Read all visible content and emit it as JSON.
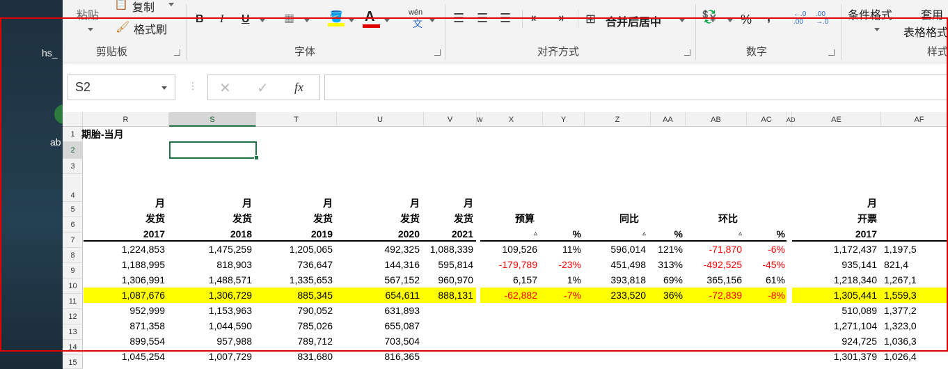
{
  "desktop": {
    "labels": [
      "hs_",
      "ab"
    ]
  },
  "ribbon": {
    "clipboard": {
      "paste": "粘贴",
      "copy": "复制",
      "format_painter": "格式刷",
      "group_label": "剪贴板"
    },
    "font": {
      "bold": "B",
      "italic": "I",
      "underline": "U",
      "group_label": "字体",
      "pinyin": "wén"
    },
    "alignment": {
      "merge_center": "合并后居中",
      "group_label": "对齐方式"
    },
    "number": {
      "percent": "%",
      "comma": ",",
      "group_label": "数字"
    },
    "styles": {
      "conditional_format": "条件格式",
      "table_format_1": "套用",
      "table_format_2": "表格格式",
      "group_label": "样式"
    }
  },
  "formula_bar": {
    "name_box": "S2",
    "cancel": "✕",
    "enter": "✓",
    "fx": "fx",
    "value": ""
  },
  "columns": [
    "R",
    "S",
    "T",
    "U",
    "V",
    "W",
    "X",
    "Y",
    "Z",
    "AA",
    "AB",
    "AC",
    "AD",
    "AE",
    "AF"
  ],
  "rows": [
    "1",
    "2",
    "3",
    "4",
    "5",
    "6",
    "7",
    "8",
    "9",
    "10",
    "11",
    "12",
    "13",
    "14",
    "15"
  ],
  "sheet": {
    "title": "期胎-当月",
    "hdr_month": "月",
    "hdr_shipment": "发货",
    "hdr_invoice": "开票",
    "hdr_budget": "预算",
    "hdr_yoy": "同比",
    "hdr_mom": "环比",
    "delta": "▵",
    "pct": "%",
    "years": [
      "2017",
      "2018",
      "2019",
      "2020",
      "2021"
    ],
    "ae_year": "2017",
    "af_header_fragments": [
      "开",
      "2"
    ],
    "data": [
      {
        "row": "8",
        "r": "1,224,853",
        "s": "1,475,259",
        "t": "1,205,065",
        "u": "492,325",
        "v": "1,088,339",
        "x": "109,526",
        "y": "11%",
        "z": "596,014",
        "aa": "121%",
        "ab": "-71,870",
        "ac": "-6%",
        "ae": "1,172,437",
        "af": "1,197,5"
      },
      {
        "row": "9",
        "r": "1,188,995",
        "s": "818,903",
        "t": "736,647",
        "u": "144,316",
        "v": "595,814",
        "x": "-179,789",
        "y": "-23%",
        "z": "451,498",
        "aa": "313%",
        "ab": "-492,525",
        "ac": "-45%",
        "ae": "935,141",
        "af": "821,4"
      },
      {
        "row": "10",
        "r": "1,306,991",
        "s": "1,488,571",
        "t": "1,335,653",
        "u": "567,152",
        "v": "960,970",
        "x": "6,157",
        "y": "1%",
        "z": "393,818",
        "aa": "69%",
        "ab": "365,156",
        "ac": "61%",
        "ae": "1,218,340",
        "af": "1,267,1"
      },
      {
        "row": "11",
        "r": "1,087,676",
        "s": "1,306,729",
        "t": "885,345",
        "u": "654,611",
        "v": "888,131",
        "x": "-62,882",
        "y": "-7%",
        "z": "233,520",
        "aa": "36%",
        "ab": "-72,839",
        "ac": "-8%",
        "ae": "1,305,441",
        "af": "1,559,3"
      },
      {
        "row": "12",
        "r": "952,999",
        "s": "1,153,963",
        "t": "790,052",
        "u": "631,893",
        "v": "",
        "x": "",
        "y": "",
        "z": "",
        "aa": "",
        "ab": "",
        "ac": "",
        "ae": "510,089",
        "af": "1,377,2"
      },
      {
        "row": "13",
        "r": "871,358",
        "s": "1,044,590",
        "t": "785,026",
        "u": "655,087",
        "v": "",
        "x": "",
        "y": "",
        "z": "",
        "aa": "",
        "ab": "",
        "ac": "",
        "ae": "1,271,104",
        "af": "1,323,0"
      },
      {
        "row": "14",
        "r": "899,554",
        "s": "957,988",
        "t": "789,712",
        "u": "703,504",
        "v": "",
        "x": "",
        "y": "",
        "z": "",
        "aa": "",
        "ab": "",
        "ac": "",
        "ae": "924,725",
        "af": "1,036,3"
      },
      {
        "row": "15",
        "r": "1,045,254",
        "s": "1,007,729",
        "t": "831,680",
        "u": "816,365",
        "v": "",
        "x": "",
        "y": "",
        "z": "",
        "aa": "",
        "ab": "",
        "ac": "",
        "ae": "1,301,379",
        "af": "1,026,4"
      }
    ],
    "highlight_row": "11",
    "highlight_color": "#ffff00",
    "negative_color": "#ff0000",
    "accent_green": "#217346"
  }
}
